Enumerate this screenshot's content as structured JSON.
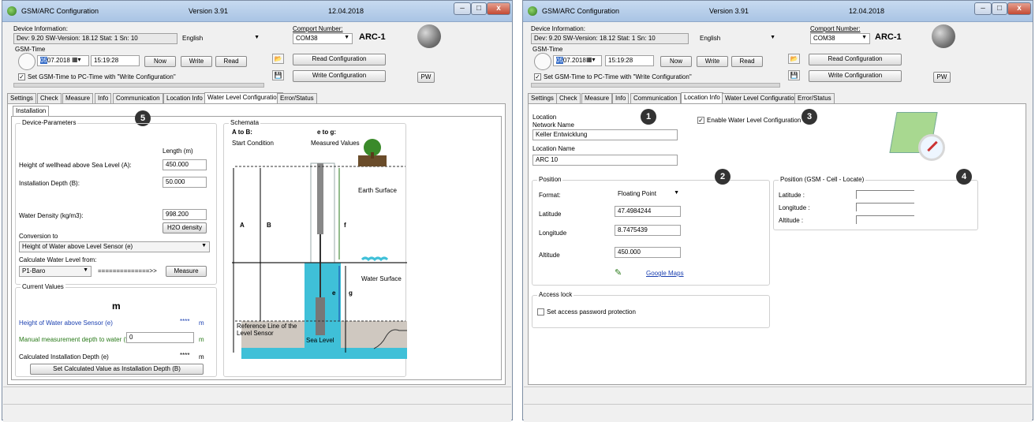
{
  "app": {
    "title": "GSM/ARC Configuration",
    "version": "Version 3.91",
    "date": "12.04.2018"
  },
  "header": {
    "device_info_label": "Device Information:",
    "device_info_value": "Dev: 9.20 SW-Version: 18.12 Stat: 1  Sn: 10",
    "language": "English",
    "comport_label": "Comport Number:",
    "comport_value": "COM38",
    "device_name": "ARC-1",
    "gsm_time_label": "GSM-Time",
    "date_value": "07.2018",
    "date_highlight": "05",
    "time_value": "15:19:28",
    "now_label": "Now",
    "write_label": "Write",
    "read_label": "Read",
    "read_config_label": "Read Configuration",
    "write_config_label": "Write Configuration",
    "pw_label": "PW",
    "set_gsm_time_label": "Set GSM-Time to PC-Time with \"Write Configuration\""
  },
  "tabs": [
    "Settings",
    "Check",
    "Measure",
    "Info",
    "Communication",
    "Location Info",
    "Water Level Configuration",
    "Error/Status"
  ],
  "left": {
    "active_tab": "Water Level Configuration",
    "subtab": "Installation",
    "badge": "5",
    "device_params": {
      "title": "Device-Parameters",
      "length_header": "Length (m)",
      "wellhead_label": "Height of wellhead above Sea Level (A):",
      "wellhead_value": "450.000",
      "install_depth_label": "Installation Depth (B):",
      "install_depth_value": "50.000",
      "density_label": "Water Density (kg/m3):",
      "density_value": "998.200",
      "h2o_button": "H2O density",
      "conversion_label": "Conversion to",
      "conversion_value": "Height of Water above Level Sensor (e)",
      "calc_from_label": "Calculate Water Level from:",
      "calc_from_value": "P1-Baro",
      "arrow_text": "==============>>",
      "measure_button": "Measure"
    },
    "current_values": {
      "title": "Current Values",
      "unit_big": "m",
      "height_label": "Height of Water above Sensor (e)",
      "height_value": "****",
      "height_unit": "m",
      "manual_label": "Manual measurement depth to water (f)",
      "manual_value": "0",
      "manual_unit": "m",
      "calc_depth_label": "Calculated Installation Depth (e)",
      "calc_depth_value": "****",
      "calc_depth_unit": "m",
      "set_button": "Set Calculated Value as Installation Depth (B)"
    },
    "schemata": {
      "title": "Schemata",
      "a_to_b": "A to B:",
      "start_condition": "Start Condition",
      "e_to_g": "e to g:",
      "measured_values": "Measured Values",
      "earth_surface": "Earth Surface",
      "water_surface": "Water Surface",
      "reference_line": "Reference Line of the Level Sensor",
      "sea_level": "Sea Level",
      "label_a": "A",
      "label_b": "B",
      "label_f": "f",
      "label_e": "e",
      "label_g": "g"
    }
  },
  "right": {
    "active_tab": "Location Info",
    "location": {
      "title": "Location",
      "network_name_label": "Network Name",
      "network_name_value": "Keller Entwicklung",
      "location_name_label": "Location Name",
      "location_name_value": "ARC 10",
      "badge": "1"
    },
    "enable_water_level": "Enable Water Level Configuration",
    "badge_enable": "3",
    "position": {
      "title": "Position",
      "badge": "2",
      "format_label": "Format:",
      "format_value": "Floating Point",
      "latitude_label": "Latitude",
      "latitude_value": "47.4984244",
      "longitude_label": "Longitude",
      "longitude_value": "8.7475439",
      "altitude_label": "Altitude",
      "altitude_value": "450.000",
      "google_maps": "Google Maps"
    },
    "position_gsm": {
      "title": "Position (GSM - Cell - Locate)",
      "badge": "4",
      "latitude_label": "Latitude :",
      "longitude_label": "Longitude :",
      "altitude_label": "Altitude :"
    },
    "access_lock": {
      "title": "Access lock",
      "password_label": "Set access password protection"
    }
  },
  "colors": {
    "water": "#3fc0d8",
    "ground": "#c8c0b8",
    "badge": "#333333",
    "link": "#1a3fb0"
  }
}
